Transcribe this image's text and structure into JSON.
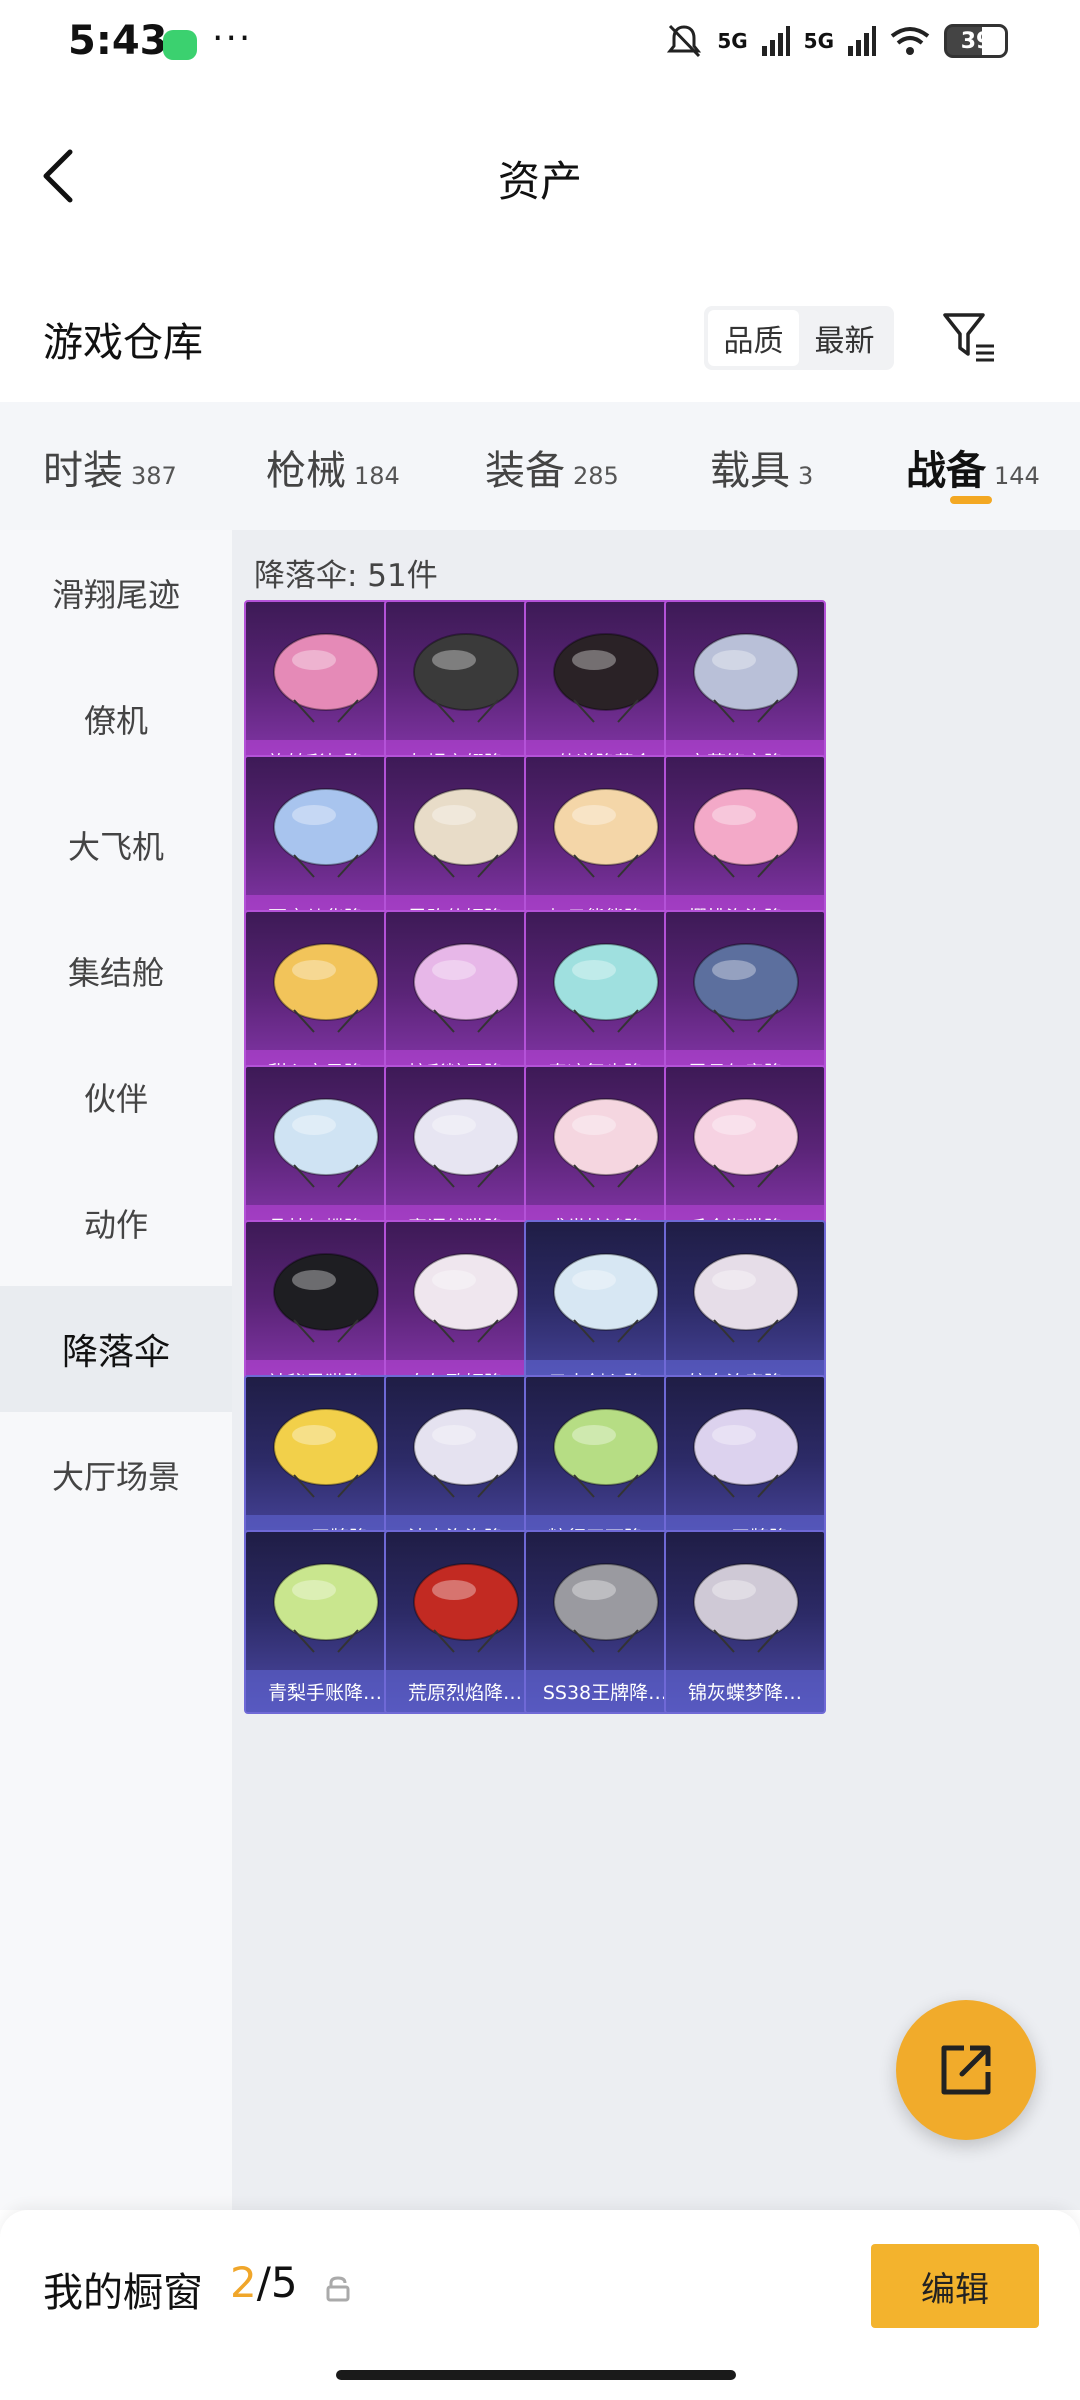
{
  "status_bar": {
    "time": "5:43",
    "more": "···",
    "network_1": "5G",
    "network_2": "5G",
    "battery": "39"
  },
  "header": {
    "title": "资产"
  },
  "section": {
    "title": "游戏仓库",
    "sort_options": [
      "品质",
      "最新"
    ]
  },
  "categories": [
    {
      "label": "时装",
      "count": "387"
    },
    {
      "label": "枪械",
      "count": "184"
    },
    {
      "label": "装备",
      "count": "285"
    },
    {
      "label": "载具",
      "count": "3"
    },
    {
      "label": "战备",
      "count": "144"
    }
  ],
  "sidebar": {
    "items": [
      "滑翔尾迹",
      "僚机",
      "大飞机",
      "集结舱",
      "伙伴",
      "动作",
      "降落伞",
      "大厅场景"
    ],
    "active": "降落伞"
  },
  "grid": {
    "header": "降落伞: 51件",
    "items": [
      {
        "name": "旋转彩虹降…",
        "rarity": "purple",
        "color": "#e58ab7"
      },
      {
        "name": "灰烬之翎降…",
        "rarity": "purple",
        "color": "#3a3a3a"
      },
      {
        "name": "仙逆降落伞",
        "rarity": "purple",
        "color": "#2a2226"
      },
      {
        "name": "夜莺箴言降…",
        "rarity": "purple",
        "color": "#b9c0d8"
      },
      {
        "name": "百变纱华降…",
        "rarity": "purple",
        "color": "#a8c4ee"
      },
      {
        "name": "灵驹仙姬降…",
        "rarity": "purple",
        "color": "#e8dcc8"
      },
      {
        "name": "虹云熊熊降…",
        "rarity": "purple",
        "color": "#f4d6a8"
      },
      {
        "name": "樱桃泡泡降…",
        "rarity": "purple",
        "color": "#f3a9c8"
      },
      {
        "name": "甜心宝贝降…",
        "rarity": "purple",
        "color": "#f2c45a"
      },
      {
        "name": "炫彩糖果降…",
        "rarity": "purple",
        "color": "#e7b7e8"
      },
      {
        "name": "奇迹舞步降…",
        "rarity": "purple",
        "color": "#9fe0df"
      },
      {
        "name": "雪月幻音降…",
        "rarity": "purple",
        "color": "#5c6f9e"
      },
      {
        "name": "晶梦幻蝶降…",
        "rarity": "purple",
        "color": "#cfe3f3"
      },
      {
        "name": "蜜语绒猫降…",
        "rarity": "purple",
        "color": "#e7e5f2"
      },
      {
        "name": "盛世惊鸿降…",
        "rarity": "purple",
        "color": "#f5d6e0"
      },
      {
        "name": "千金淑猫降…",
        "rarity": "purple",
        "color": "#f6d2e2"
      },
      {
        "name": "神秘黑猫降…",
        "rarity": "purple",
        "color": "#1e1e22"
      },
      {
        "name": "白勺歌姬降…",
        "rarity": "purple",
        "color": "#efe6ee"
      },
      {
        "name": "云水剑心降…",
        "rarity": "blue",
        "color": "#d7e7f3"
      },
      {
        "name": "皎白汐音降…",
        "rarity": "blue",
        "color": "#e6dde8"
      },
      {
        "name": "SS40王牌降…",
        "rarity": "blue",
        "color": "#f2d04a"
      },
      {
        "name": "波点泡泡降…",
        "rarity": "blue",
        "color": "#e5e2f0"
      },
      {
        "name": "粽行天下降…",
        "rarity": "blue",
        "color": "#b6dd84"
      },
      {
        "name": "SS39王牌降…",
        "rarity": "blue",
        "color": "#dcd2ee"
      },
      {
        "name": "青梨手账降…",
        "rarity": "blue",
        "color": "#c9e68e"
      },
      {
        "name": "荒原烈焰降…",
        "rarity": "blue",
        "color": "#c22a22"
      },
      {
        "name": "SS38王牌降…",
        "rarity": "blue",
        "color": "#9a9aa0"
      },
      {
        "name": "锦灰蝶梦降…",
        "rarity": "blue",
        "color": "#cfc9d6"
      }
    ]
  },
  "bottom": {
    "label": "我的橱窗",
    "current": "2",
    "total": "/5",
    "edit_label": "编辑"
  },
  "accent": "#f3b32d"
}
